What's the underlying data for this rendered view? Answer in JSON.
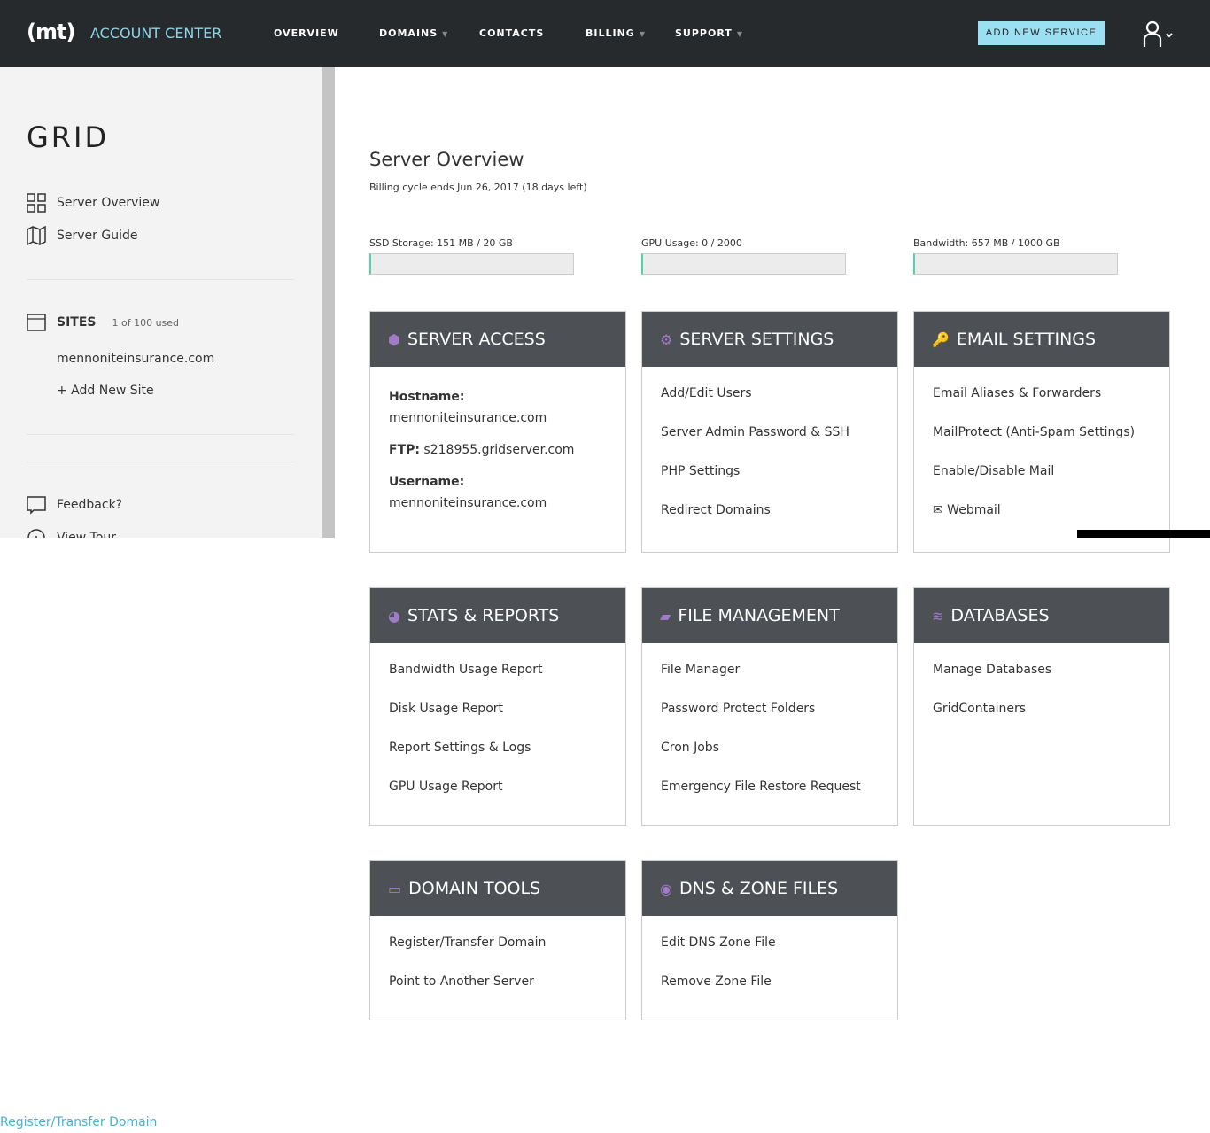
{
  "header": {
    "logo": "(mt)",
    "brand": "ACCOUNT CENTER",
    "nav": [
      {
        "label": "OVERVIEW",
        "caret": false
      },
      {
        "label": "DOMAINS",
        "caret": true
      },
      {
        "label": "CONTACTS",
        "caret": false
      },
      {
        "label": "BILLING",
        "caret": true
      },
      {
        "label": "SUPPORT",
        "caret": true
      }
    ],
    "add_service": "ADD NEW SERVICE",
    "caret_glyph": "▼"
  },
  "sidebar": {
    "title": "GRID",
    "items": [
      {
        "label": "Server Overview",
        "icon": "grid-icon"
      },
      {
        "label": "Server Guide",
        "icon": "map-icon"
      }
    ],
    "sites_label": "SITES",
    "sites_count": "1 of 100 used",
    "site": "mennoniteinsurance.com",
    "add_site": "+ Add New Site",
    "feedback": "Feedback?",
    "tour": "View Tour"
  },
  "main": {
    "title": "Server Overview",
    "billing_prefix": "Billing cycle ends ",
    "billing_date": "Jun 26, 2017",
    "billing_suffix": " (18 days left)",
    "meters": [
      {
        "label": "SSD Storage: 151 MB / 20 GB",
        "fraction": 0.007
      },
      {
        "label": "GPU Usage: 0 / 2000",
        "fraction": 0
      },
      {
        "label": "Bandwidth: 657 MB / 1000 GB",
        "fraction": 0.0007
      }
    ],
    "access": {
      "title": "SERVER ACCESS",
      "hostname_label": "Hostname:",
      "hostname": "mennoniteinsurance.com",
      "ftp_label": "FTP:",
      "ftp": " s218955.gridserver.com",
      "user_label": "Username:",
      "username": "mennoniteinsurance.com"
    },
    "cards": [
      {
        "title": "SERVER SETTINGS",
        "icon": "⚙",
        "links": [
          "Add/Edit Users",
          "Server Admin Password & SSH",
          "PHP Settings",
          "Redirect Domains"
        ]
      },
      {
        "title": "EMAIL SETTINGS",
        "icon": "🔑",
        "links": [
          "Email Aliases & Forwarders",
          "MailProtect (Anti-Spam Settings)",
          "Enable/Disable Mail",
          "✉ Webmail"
        ]
      },
      {
        "title": "STATS & REPORTS",
        "icon": "◕",
        "links": [
          "Bandwidth Usage Report",
          "Disk Usage Report",
          "Report Settings & Logs",
          "GPU Usage Report"
        ]
      },
      {
        "title": "FILE MANAGEMENT",
        "icon": "▰",
        "links": [
          "File Manager",
          "Password Protect Folders",
          "Cron Jobs",
          "Emergency File Restore Request"
        ]
      },
      {
        "title": "DATABASES",
        "icon": "≋",
        "links": [
          "Manage Databases",
          "GridContainers"
        ]
      },
      {
        "title": "DOMAIN TOOLS",
        "icon": "▭",
        "links": [
          "Register/Transfer Domain",
          "Point to Another Server"
        ]
      },
      {
        "title": "DNS & ZONE FILES",
        "icon": "◉",
        "links": [
          "Edit DNS Zone File",
          "Remove Zone File"
        ]
      }
    ]
  },
  "footer_link": "Register/Transfer Domain"
}
